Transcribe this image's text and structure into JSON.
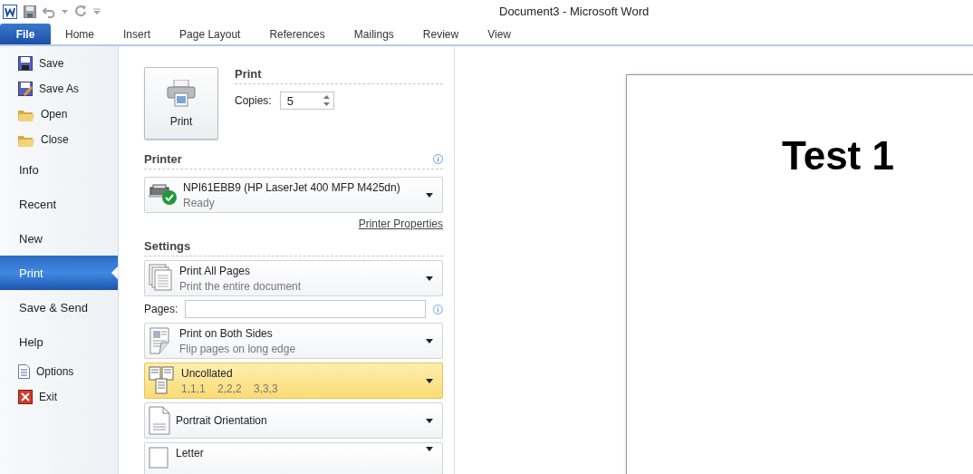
{
  "window": {
    "title": "Document3 - Microsoft Word"
  },
  "ribbon_tabs": [
    {
      "label": "File",
      "selected": true
    },
    {
      "label": "Home",
      "selected": false
    },
    {
      "label": "Insert",
      "selected": false
    },
    {
      "label": "Page Layout",
      "selected": false
    },
    {
      "label": "References",
      "selected": false
    },
    {
      "label": "Mailings",
      "selected": false
    },
    {
      "label": "Review",
      "selected": false
    },
    {
      "label": "View",
      "selected": false
    }
  ],
  "nav": [
    {
      "kind": "command",
      "label": "Save",
      "selected": false
    },
    {
      "kind": "command",
      "label": "Save As",
      "selected": false
    },
    {
      "kind": "command",
      "label": "Open",
      "selected": false
    },
    {
      "kind": "command",
      "label": "Close",
      "selected": false
    },
    {
      "kind": "tab",
      "label": "Info",
      "selected": false
    },
    {
      "kind": "tab",
      "label": "Recent",
      "selected": false
    },
    {
      "kind": "tab",
      "label": "New",
      "selected": false
    },
    {
      "kind": "tab",
      "label": "Print",
      "selected": true
    },
    {
      "kind": "tab",
      "label": "Save & Send",
      "selected": false
    },
    {
      "kind": "tab",
      "label": "Help",
      "selected": false
    },
    {
      "kind": "command",
      "label": "Options",
      "selected": false
    },
    {
      "kind": "command",
      "label": "Exit",
      "selected": false
    }
  ],
  "print": {
    "button": "Print",
    "heading": "Print",
    "copies_label": "Copies:",
    "copies": "5"
  },
  "printer": {
    "heading": "Printer",
    "name": "NPI61EBB9 (HP LaserJet 400 MFP M425dn)",
    "status": "Ready",
    "properties_link": "Printer Properties"
  },
  "settings": {
    "heading": "Settings",
    "items": [
      {
        "kind": "dropdown",
        "title": "Print All Pages",
        "subtitle": "Print the entire document",
        "hovered": false
      },
      {
        "kind": "field",
        "label": "Pages:"
      },
      {
        "kind": "dropdown",
        "title": "Print on Both Sides",
        "subtitle": "Flip pages on long edge",
        "hovered": false
      },
      {
        "kind": "dropdown",
        "title": "Uncollated",
        "subtitle": "1,1,1    2,2,2    3,3,3",
        "hovered": true
      },
      {
        "kind": "dropdown",
        "title": "Portrait Orientation",
        "hovered": false
      },
      {
        "kind": "dropdown",
        "title": "Letter",
        "hovered": false
      }
    ]
  },
  "preview": {
    "text": "Test 1"
  }
}
